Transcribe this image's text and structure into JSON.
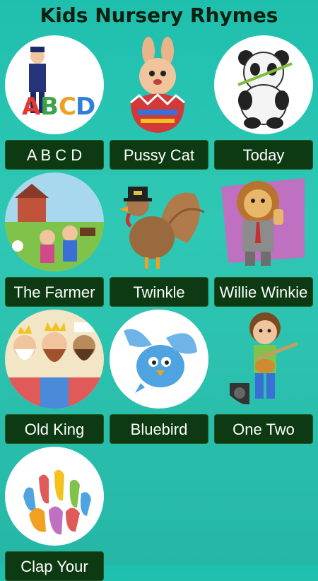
{
  "app": {
    "title": "Kids Nursery Rhymes"
  },
  "rhymes": [
    {
      "label": "A B C D",
      "icon": "policeman-abcd-icon"
    },
    {
      "label": "Pussy Cat",
      "icon": "bunny-egg-icon"
    },
    {
      "label": "Today",
      "icon": "panda-icon"
    },
    {
      "label": "The Farmer",
      "icon": "farm-scene-icon"
    },
    {
      "label": "Twinkle",
      "icon": "turkey-pilgrim-icon"
    },
    {
      "label": "Willie Winkie",
      "icon": "lion-thumbs-up-icon"
    },
    {
      "label": "Old King",
      "icon": "three-kings-icon"
    },
    {
      "label": "Bluebird",
      "icon": "bluebird-icon"
    },
    {
      "label": "One Two",
      "icon": "boy-guitar-icon"
    },
    {
      "label": "Clap Your",
      "icon": "colorful-hands-icon"
    }
  ]
}
